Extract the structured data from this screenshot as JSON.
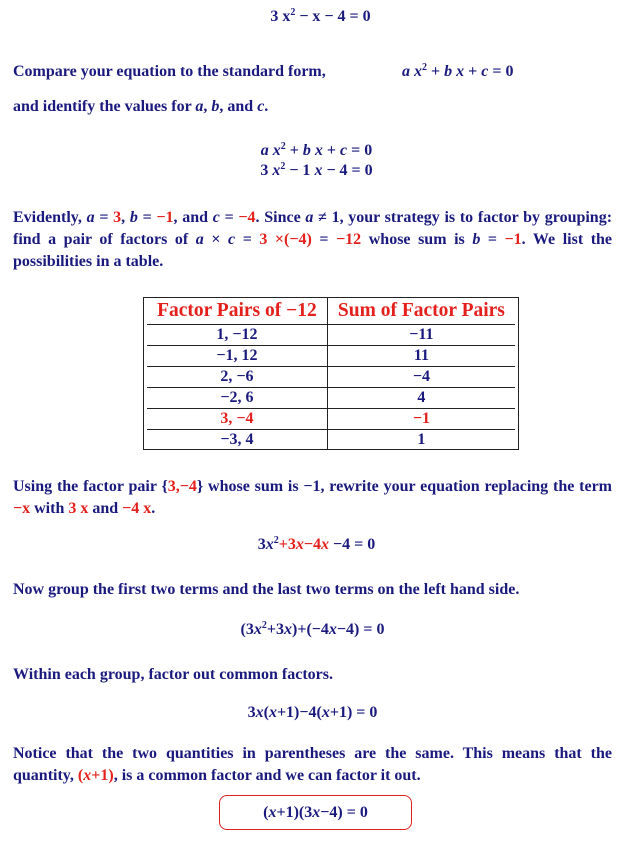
{
  "colors": {
    "text": "#1a1a7e",
    "accent": "#e3201b"
  },
  "title_equation": [
    {
      "t": "3 x"
    },
    {
      "t": "2",
      "s": "sup"
    },
    {
      "t": " − x − 4 = 0"
    }
  ],
  "compare_line": [
    {
      "t": "Compare your equation to the standard form,"
    }
  ],
  "standard_form": [
    {
      "t": "a",
      "s": "i"
    },
    {
      "t": " x",
      "s": "i"
    },
    {
      "t": "2",
      "s": "sup"
    },
    {
      "t": " + "
    },
    {
      "t": "b",
      "s": "i"
    },
    {
      "t": " x",
      "s": "i"
    },
    {
      "t": " + "
    },
    {
      "t": "c",
      "s": "i"
    },
    {
      "t": "  =  0"
    }
  ],
  "identify_line": [
    {
      "t": "and identify the values for "
    },
    {
      "t": "a",
      "s": "i"
    },
    {
      "t": ", "
    },
    {
      "t": "b",
      "s": "i"
    },
    {
      "t": ", and "
    },
    {
      "t": "c",
      "s": "i"
    },
    {
      "t": "."
    }
  ],
  "eq_general": [
    {
      "t": "a",
      "s": "i"
    },
    {
      "t": " x",
      "s": "i"
    },
    {
      "t": "2",
      "s": "sup"
    },
    {
      "t": " + "
    },
    {
      "t": "b",
      "s": "i"
    },
    {
      "t": " x",
      "s": "i"
    },
    {
      "t": " + "
    },
    {
      "t": "c",
      "s": "i"
    },
    {
      "t": "  =  0"
    }
  ],
  "eq_specific": [
    {
      "t": "3 "
    },
    {
      "t": "x",
      "s": "i"
    },
    {
      "t": "2",
      "s": "sup"
    },
    {
      "t": " − 1 "
    },
    {
      "t": "x",
      "s": "i"
    },
    {
      "t": " − 4  =  0"
    }
  ],
  "evidently_para": [
    {
      "t": "Evidently, "
    },
    {
      "t": "a",
      "s": "i"
    },
    {
      "t": " = "
    },
    {
      "t": "3",
      "s": "r"
    },
    {
      "t": ", "
    },
    {
      "t": "b",
      "s": "i"
    },
    {
      "t": " = "
    },
    {
      "t": "−1",
      "s": "r"
    },
    {
      "t": ", and "
    },
    {
      "t": "c",
      "s": "i"
    },
    {
      "t": " = "
    },
    {
      "t": "−4",
      "s": "r"
    },
    {
      "t": ".  Since "
    },
    {
      "t": "a",
      "s": "i"
    },
    {
      "t": " ≠ 1, your strategy is to factor by grouping: find a pair of factors of "
    },
    {
      "t": "a",
      "s": "i"
    },
    {
      "t": " × "
    },
    {
      "t": "c",
      "s": "i"
    },
    {
      "t": " = "
    },
    {
      "t": " 3 ×(−4)",
      "s": "r"
    },
    {
      "t": " = "
    },
    {
      "t": "−12",
      "s": "r"
    },
    {
      "t": " whose sum is "
    },
    {
      "t": "b",
      "s": "i"
    },
    {
      "t": " = "
    },
    {
      "t": "−1",
      "s": "r"
    },
    {
      "t": ". We list the possibilities in a table."
    }
  ],
  "table": {
    "headers": [
      "Factor Pairs of −12",
      "Sum of Factor Pairs"
    ],
    "rows": [
      {
        "pair": "1, −12",
        "sum": "−11",
        "highlight": false
      },
      {
        "pair": "−1, 12",
        "sum": "11",
        "highlight": false
      },
      {
        "pair": "2, −6",
        "sum": "−4",
        "highlight": false
      },
      {
        "pair": "−2, 6",
        "sum": "4",
        "highlight": false
      },
      {
        "pair": "3, −4",
        "sum": "−1",
        "highlight": true
      },
      {
        "pair": "−3, 4",
        "sum": "1",
        "highlight": false
      }
    ]
  },
  "using_para": [
    {
      "t": "Using the factor pair {"
    },
    {
      "t": "3,−4",
      "s": "r"
    },
    {
      "t": "} whose sum is −1, rewrite your equation replacing the term "
    },
    {
      "t": "−x",
      "s": "r"
    },
    {
      "t": " with "
    },
    {
      "t": "3 x",
      "s": "r"
    },
    {
      "t": " and "
    },
    {
      "t": "−4 x",
      "s": "r"
    },
    {
      "t": "."
    }
  ],
  "eq_rewrite": [
    {
      "t": "3"
    },
    {
      "t": "x",
      "s": "i"
    },
    {
      "t": "2",
      "s": "sup"
    },
    {
      "t": "+3",
      "s": "r"
    },
    {
      "t": "x",
      "s": "ri"
    },
    {
      "t": "−4",
      "s": "r"
    },
    {
      "t": "x",
      "s": "ri"
    },
    {
      "t": " −4 = 0"
    }
  ],
  "group_line": [
    {
      "t": "Now group the first two terms and the last two terms on the left hand side."
    }
  ],
  "eq_grouped": [
    {
      "t": "(3"
    },
    {
      "t": "x",
      "s": "i"
    },
    {
      "t": "2",
      "s": "sup"
    },
    {
      "t": "+3"
    },
    {
      "t": "x",
      "s": "i"
    },
    {
      "t": ")+(−4"
    },
    {
      "t": "x",
      "s": "i"
    },
    {
      "t": "−4) = 0"
    }
  ],
  "within_line": [
    {
      "t": "Within each group, factor out common factors."
    }
  ],
  "eq_factored": [
    {
      "t": "3"
    },
    {
      "t": "x",
      "s": "i"
    },
    {
      "t": "("
    },
    {
      "t": "x",
      "s": "i"
    },
    {
      "t": "+1)−4("
    },
    {
      "t": "x",
      "s": "i"
    },
    {
      "t": "+1) = 0"
    }
  ],
  "notice_para": [
    {
      "t": "Notice that the two quantities in parentheses are the same. This means that the quantity, "
    },
    {
      "t": "(",
      "s": "r"
    },
    {
      "t": "x",
      "s": "ri"
    },
    {
      "t": "+1)",
      "s": "r"
    },
    {
      "t": ", is a common factor and we can factor it out."
    }
  ],
  "final_equation": [
    {
      "t": "("
    },
    {
      "t": "x",
      "s": "i"
    },
    {
      "t": "+1)(3"
    },
    {
      "t": "x",
      "s": "i"
    },
    {
      "t": "−4) = 0"
    }
  ]
}
